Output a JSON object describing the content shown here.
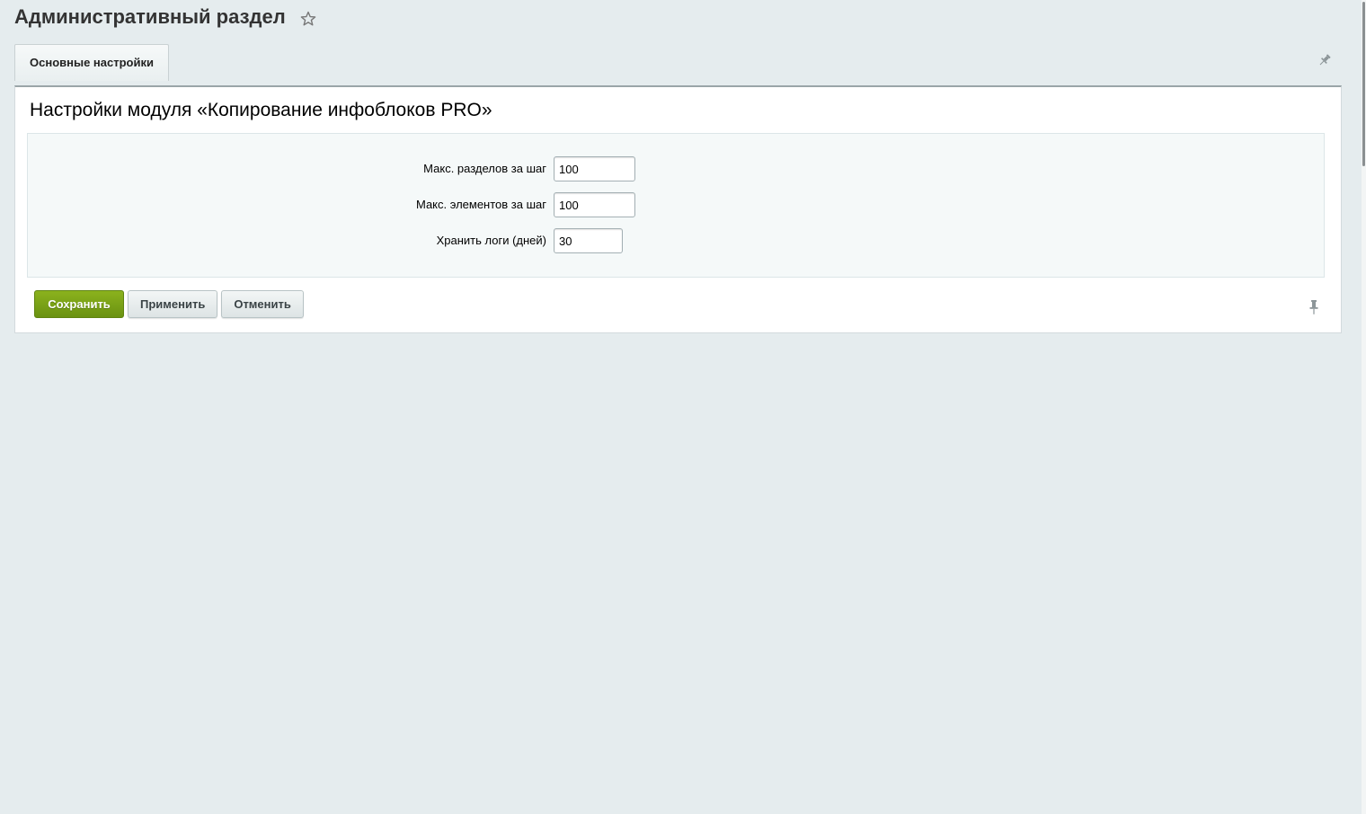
{
  "header": {
    "title": "Административный раздел",
    "favorite_icon": "star-outline-icon"
  },
  "tabs": [
    {
      "label": "Основные настройки",
      "active": true
    }
  ],
  "panel": {
    "title": "Настройки модуля «Копирование инфоблоков PRO»",
    "fields": [
      {
        "label": "Макс. разделов за шаг",
        "value": "100"
      },
      {
        "label": "Макс. элементов за шаг",
        "value": "100"
      },
      {
        "label": "Хранить логи (дней)",
        "value": "30"
      }
    ]
  },
  "buttons": {
    "save": "Сохранить",
    "apply": "Применить",
    "cancel": "Отменить"
  },
  "icons": {
    "tabs_pin": "pin-icon",
    "footer_pin": "pin-icon"
  },
  "colors": {
    "background": "#e5ecee",
    "save_button": "#7aa318",
    "panel_border": "#9aa5a8"
  }
}
